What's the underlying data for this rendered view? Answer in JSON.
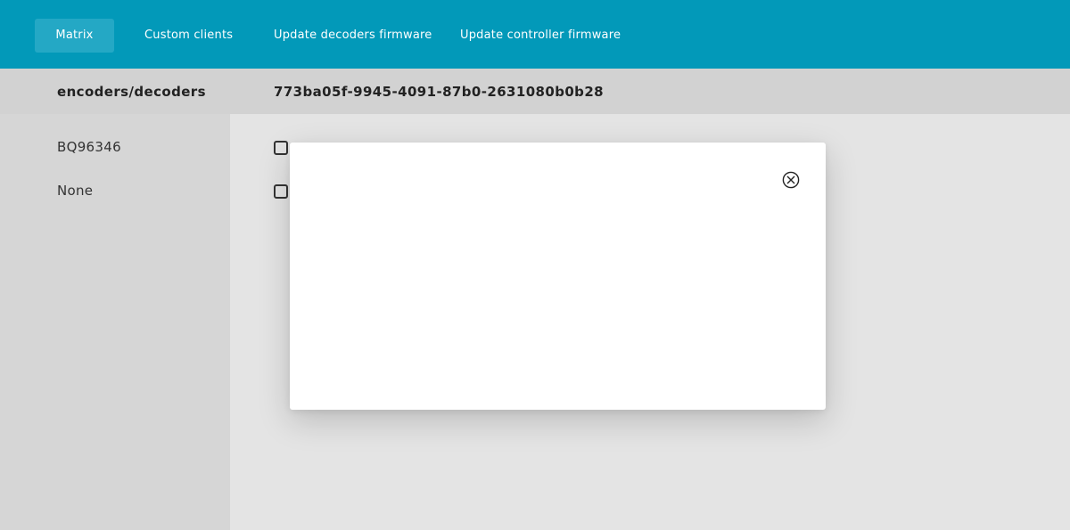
{
  "nav": {
    "items": [
      {
        "label": "Matrix",
        "active": true
      },
      {
        "label": "Custom clients",
        "active": false
      },
      {
        "label": "Update decoders firmware",
        "active": false
      },
      {
        "label": "Update controller firmware",
        "active": false
      }
    ]
  },
  "sidebar": {
    "title": "encoders/decoders",
    "items": [
      {
        "label": "BQ96346"
      },
      {
        "label": "None"
      }
    ]
  },
  "main": {
    "title": "773ba05f-9945-4091-87b0-2631080b0b28",
    "checkboxes": [
      {
        "checked": false
      },
      {
        "checked": false
      }
    ]
  },
  "modal": {
    "close_icon": "close-circle-icon"
  },
  "colors": {
    "topbar": "#0299b9",
    "nav_active": "#24a8c5",
    "sidebar": "#d6d6d6",
    "header": "#d2d2d2",
    "content": "#e4e4e4",
    "modal": "#ffffff"
  }
}
